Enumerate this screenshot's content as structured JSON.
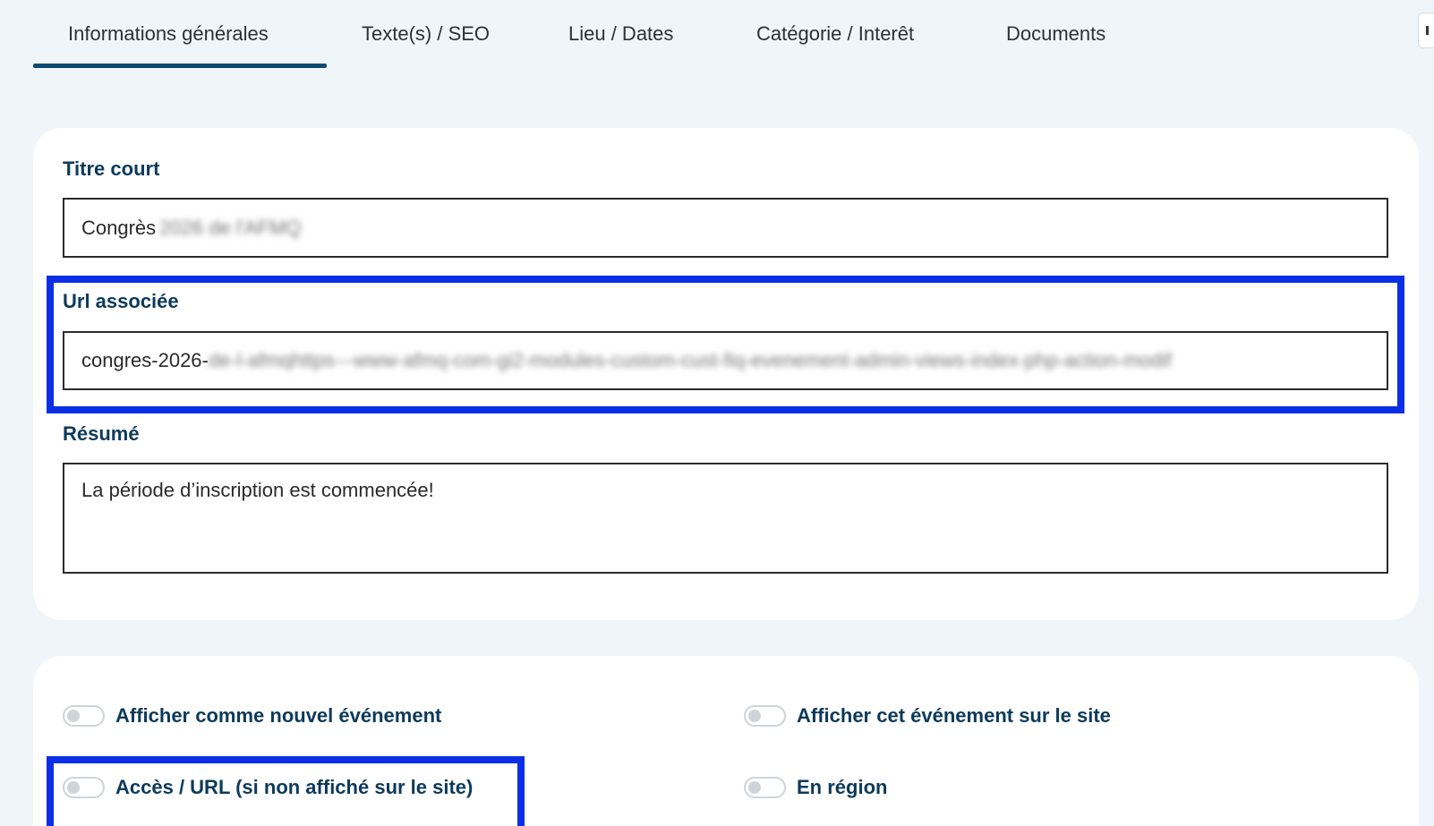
{
  "tabs": [
    {
      "label": "Informations générales",
      "active": true
    },
    {
      "label": "Texte(s) / SEO",
      "active": false
    },
    {
      "label": "Lieu / Dates",
      "active": false
    },
    {
      "label": "Catégorie / Interêt",
      "active": false
    },
    {
      "label": "Documents",
      "active": false
    }
  ],
  "form": {
    "titre_court": {
      "label": "Titre court",
      "value": "Congrès",
      "value_blurred": "2026 de l'AFMQ"
    },
    "url": {
      "label": "Url associée",
      "value": "congres-2026-",
      "value_blurred": "de-l-afmqhttps---www-afmq-com-gi2-modules-custom-cust-fiq-evenement-admin-views-index-php-action-modif"
    },
    "resume": {
      "label": "Résumé",
      "value": "La période d’inscription est commencée!"
    }
  },
  "toggles": [
    {
      "label": "Afficher comme nouvel événement",
      "checked": false
    },
    {
      "label": "Afficher cet événement sur le site",
      "checked": false
    },
    {
      "label": "Accès / URL (si non affiché sur le site)",
      "checked": false
    },
    {
      "label": "En région",
      "checked": false
    }
  ],
  "colors": {
    "background": "#f0f5f9",
    "accent": "#0e4a72",
    "label": "#0d3a5a",
    "highlight": "#0a2fe6"
  }
}
